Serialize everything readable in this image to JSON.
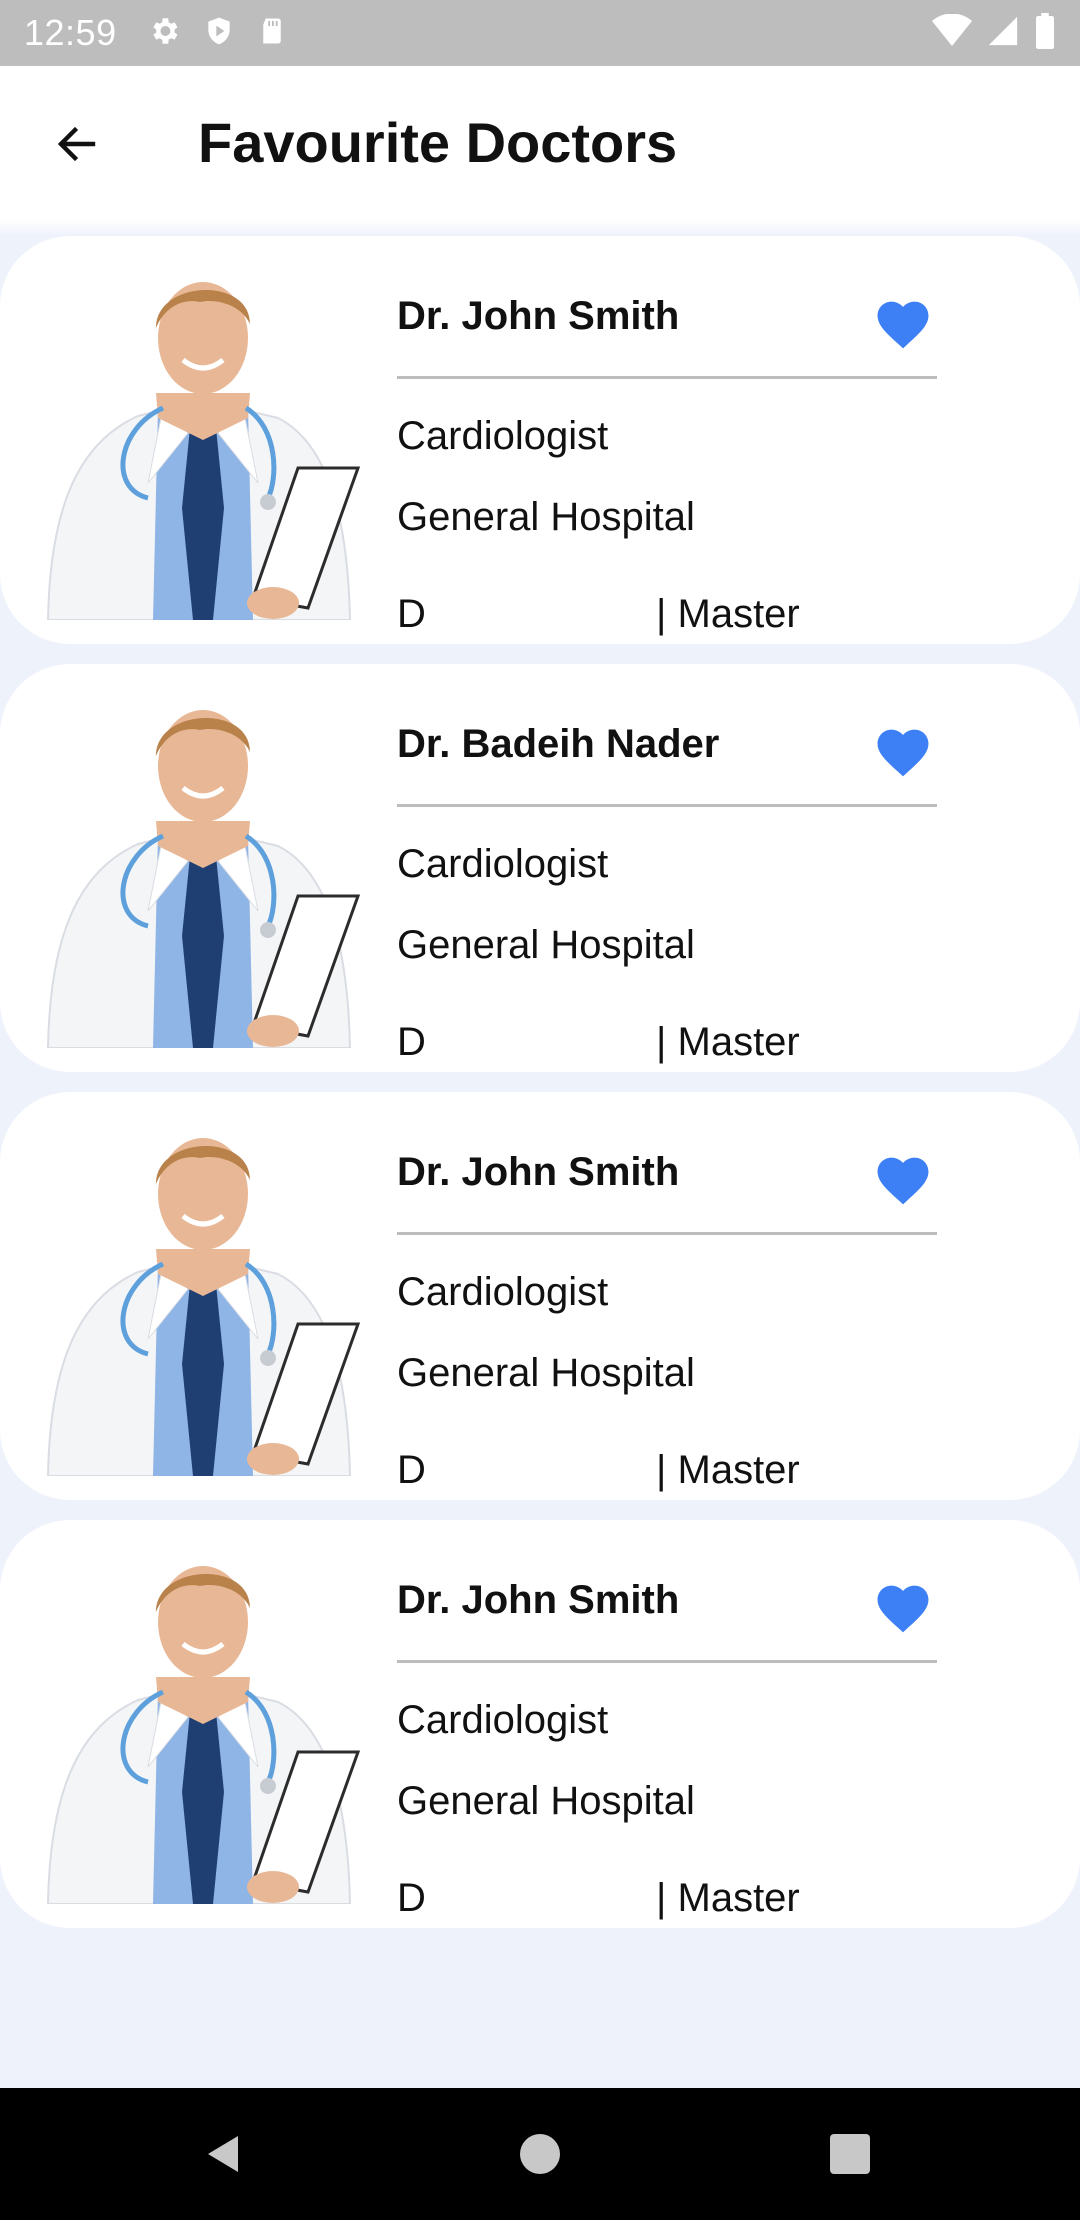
{
  "status_bar": {
    "time": "12:59"
  },
  "header": {
    "title": "Favourite Doctors"
  },
  "doctors": [
    {
      "name": "Dr. John Smith",
      "specialty": "Cardiologist",
      "hospital": "General Hospital",
      "degree": "D",
      "level": "| Master",
      "favorite": true
    },
    {
      "name": "Dr. Badeih Nader",
      "specialty": "Cardiologist",
      "hospital": "General Hospital",
      "degree": "D",
      "level": "| Master",
      "favorite": true
    },
    {
      "name": "Dr. John Smith",
      "specialty": "Cardiologist",
      "hospital": "General Hospital",
      "degree": "D",
      "level": "| Master",
      "favorite": true
    },
    {
      "name": "Dr. John Smith",
      "specialty": "Cardiologist",
      "hospital": "General Hospital",
      "degree": "D",
      "level": "| Master",
      "favorite": true
    }
  ],
  "colors": {
    "accent": "#3d7ff5",
    "background": "#eef2fb",
    "card": "#ffffff"
  },
  "icons": {
    "back": "arrow-left-icon",
    "favorite": "heart-icon",
    "status": [
      "gear-icon",
      "shield-icon",
      "sd-card-icon",
      "wifi-icon",
      "signal-icon",
      "battery-icon"
    ],
    "nav": [
      "back-triangle-icon",
      "home-circle-icon",
      "recents-square-icon"
    ]
  }
}
